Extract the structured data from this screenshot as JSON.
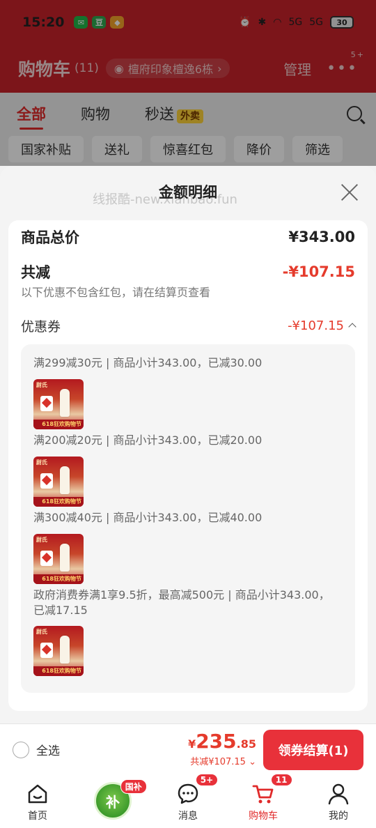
{
  "statusbar": {
    "time": "15:20",
    "apps": [
      {
        "icon": "wechat-icon",
        "text": "✉",
        "color": "#22b84a"
      },
      {
        "icon": "douyu-icon",
        "text": "豆",
        "color": "#2fa84f"
      },
      {
        "icon": "taobao-icon",
        "text": "◆",
        "color": "#f4a32a"
      }
    ],
    "network1": "5G",
    "network2": "5G",
    "battery": "30"
  },
  "header": {
    "title": "购物车",
    "count": "(11)",
    "address": "檀府印象檀逸6栋",
    "manage": "管理",
    "more_badge": "5+"
  },
  "tabs": [
    {
      "label": "全部",
      "active": true
    },
    {
      "label": "购物",
      "active": false
    },
    {
      "label": "秒送",
      "active": false,
      "tag": "外卖"
    }
  ],
  "chips": [
    "国家补贴",
    "送礼",
    "惊喜红包",
    "降价",
    "筛选"
  ],
  "sheet": {
    "title": "金额明细",
    "watermark": "线报酷-new.xianbao.fun",
    "total_label": "商品总价",
    "total_amount": "¥343.00",
    "discount_label": "共减",
    "discount_amount": "-¥107.15",
    "note": "以下优惠不包含红包，请在结算页查看",
    "coupon_label": "优惠券",
    "coupon_amount": "-¥107.15",
    "coupons": [
      {
        "text": "满299减30元 | 商品小计343.00，已减30.00",
        "thumb_caption": "618狂欢购物节",
        "thumb_brand": "尉氏"
      },
      {
        "text": "满200减20元 | 商品小计343.00，已减20.00",
        "thumb_caption": "618狂欢购物节",
        "thumb_brand": "尉氏"
      },
      {
        "text": "满300减40元 | 商品小计343.00，已减40.00",
        "thumb_caption": "618狂欢购物节",
        "thumb_brand": "尉氏"
      },
      {
        "text": "政府消费券满1享9.5折，最高减500元 | 商品小计343.00，已减17.15",
        "thumb_caption": "618狂欢购物节",
        "thumb_brand": "尉氏"
      }
    ]
  },
  "bottom": {
    "select_all": "全选",
    "price_currency": "¥",
    "price_int": "235",
    "price_dec": ".85",
    "price_sub": "共减¥107.15",
    "checkout": "领券结算(1)"
  },
  "tabbar": [
    {
      "label": "首页",
      "icon": "home-icon"
    },
    {
      "label": "",
      "icon": "subsidy-icon",
      "badge": "国补",
      "center_text": "补"
    },
    {
      "label": "消息",
      "icon": "message-icon",
      "badge": "5+"
    },
    {
      "label": "购物车",
      "icon": "cart-icon",
      "badge": "11",
      "active": true
    },
    {
      "label": "我的",
      "icon": "profile-icon"
    }
  ]
}
